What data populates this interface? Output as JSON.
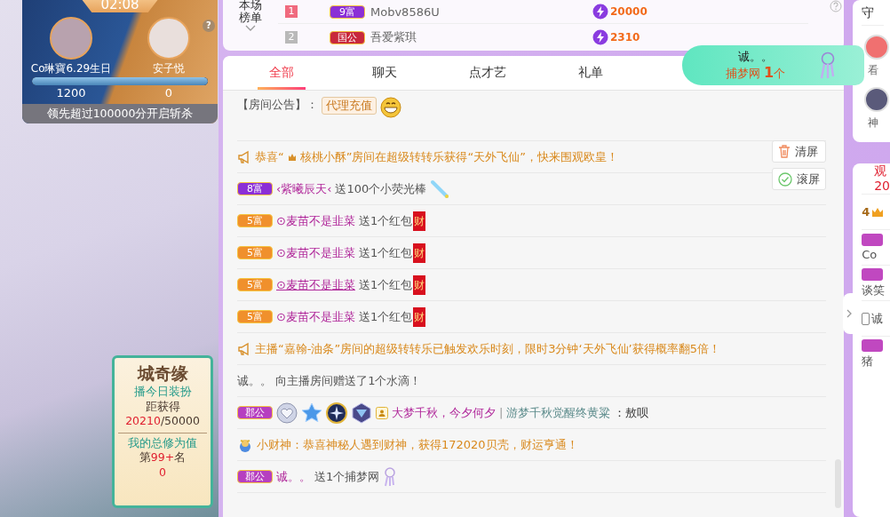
{
  "pk": {
    "timer": "02:08",
    "help": "?",
    "left": {
      "name": "Co琳寶6.29生日",
      "score": "1200"
    },
    "right": {
      "name": "安子悦",
      "score": "0"
    },
    "level": 1,
    "banner": "领先超过100000分开启斩杀"
  },
  "outfit_card": {
    "title": "城奇缘",
    "line1": "播今日装扮",
    "line2": "距获得",
    "progress": "20210",
    "goal": "/50000",
    "line3": "我的总修为值",
    "rank_prefix": "第",
    "rank": "99+",
    "rank_suffix": "名",
    "value": "0"
  },
  "rank_board": {
    "label": "本场榜单",
    "rows": [
      {
        "rank": "1",
        "color": "#f06a7e",
        "badge": {
          "text": "9富",
          "color": "#8b2fd6"
        },
        "name": "Mobv8586U",
        "score": "20000"
      },
      {
        "rank": "2",
        "color": "#b9b9b9",
        "badge": {
          "text": "国公",
          "color": "#c8283c"
        },
        "name": "吾爱紫琪",
        "score": "2310"
      }
    ]
  },
  "tabs": [
    {
      "label": "全部",
      "selected": true
    },
    {
      "label": "聊天",
      "selected": false
    },
    {
      "label": "点才艺",
      "selected": false
    },
    {
      "label": "礼单",
      "selected": false
    }
  ],
  "messages": [
    {
      "kind": "notice",
      "label": "【房间公告】：",
      "tag": "代理充值"
    },
    {
      "kind": "system",
      "pre": "恭喜“",
      "text": "核桃小酥”房间在超级转转乐获得“天外飞仙”，快来围观欧皇！"
    },
    {
      "kind": "gift",
      "badge": {
        "text": "8富",
        "color": "#8b2fd6"
      },
      "user": "‹紫曦辰天‹",
      "hover": false,
      "text": "送100个小荧光棒",
      "gift": {
        "kind": "stick"
      }
    },
    {
      "kind": "gift",
      "badge": {
        "text": "5富",
        "color": "#f0902c"
      },
      "user": "⊙麦苗不是韭菜",
      "hover": false,
      "text": "送1个红包",
      "gift": {
        "kind": "envelope",
        "text": "财"
      }
    },
    {
      "kind": "gift",
      "badge": {
        "text": "5富",
        "color": "#f0902c"
      },
      "user": "⊙麦苗不是韭菜",
      "hover": false,
      "text": "送1个红包",
      "gift": {
        "kind": "envelope",
        "text": "财"
      }
    },
    {
      "kind": "gift",
      "badge": {
        "text": "5富",
        "color": "#f0902c"
      },
      "user": "⊙麦苗不是韭菜",
      "hover": true,
      "text": "送1个红包",
      "gift": {
        "kind": "envelope",
        "text": "财"
      }
    },
    {
      "kind": "gift",
      "badge": {
        "text": "5富",
        "color": "#f0902c"
      },
      "user": "⊙麦苗不是韭菜",
      "hover": false,
      "text": "送1个红包",
      "gift": {
        "kind": "envelope",
        "text": "财"
      }
    },
    {
      "kind": "system",
      "text": "主播“嘉翰-油条”房间的超级转转乐已触发欢乐时刻，限时3分钟‘天外飞仙’获得概率翻5倍！"
    },
    {
      "kind": "text",
      "text": "诚。。 向主播房间赠送了1个水滴！"
    },
    {
      "kind": "chat",
      "badge": {
        "text": "郡公",
        "color": "#b63fc0"
      },
      "medals": [
        {
          "kind": "heart"
        },
        {
          "kind": "star"
        },
        {
          "kind": "sparkle"
        },
        {
          "kind": "gem"
        }
      ],
      "user": "大梦千秋，今夕何夕",
      "sep": "|",
      "title": "游梦千秋觉醒终黄粱",
      "text": "：敖呗"
    },
    {
      "kind": "fortune",
      "text": "小财神：恭喜神秘人遇到财神，获得172020贝壳，财运亨通！"
    },
    {
      "kind": "gift",
      "badge": {
        "text": "郡公",
        "color": "#b63fc0"
      },
      "user": "诚。。",
      "hover": false,
      "text": "送1个捕梦网",
      "gift": {
        "kind": "dreamcatcher"
      }
    }
  ],
  "chat_tools": [
    {
      "kind": "clear",
      "label": "清屏"
    },
    {
      "kind": "scroll",
      "label": "滚屏",
      "on": true
    }
  ],
  "gift_toast": {
    "user": "诚。。",
    "text": "捕梦网 **1**个"
  },
  "side": {
    "guard_title": "守",
    "guards": [
      "看",
      "神"
    ],
    "viewers_title": "观",
    "viewers_count": "20",
    "viewers": [
      {
        "text": "4",
        "kind": "crown"
      },
      {
        "text": "Co",
        "kind": "plain"
      },
      {
        "text": "谈笑",
        "kind": "plain"
      },
      {
        "text": "诚",
        "kind": "phone"
      },
      {
        "text": "猪",
        "kind": "plain"
      }
    ]
  }
}
